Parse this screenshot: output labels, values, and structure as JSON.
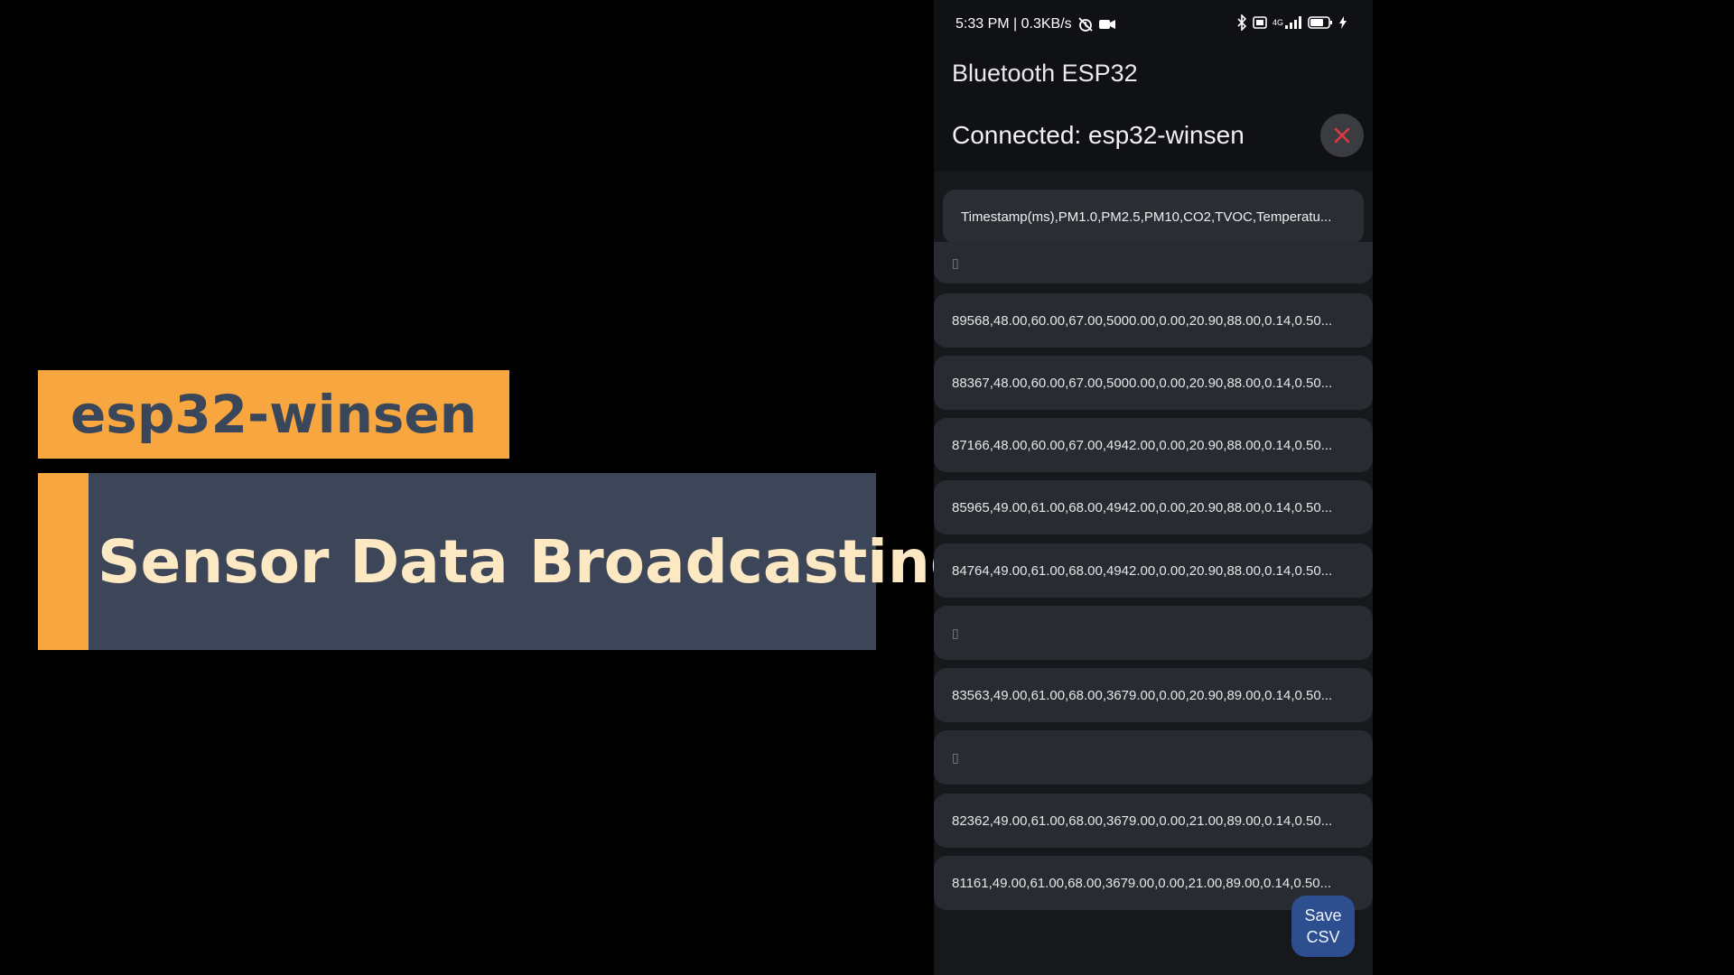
{
  "overlay": {
    "tag": "esp32-winsen",
    "banner": "Sensor Data Broadcasting",
    "colors": {
      "accent": "#f8a63f",
      "banner_bg": "#3d4658",
      "banner_text": "#fde8c4",
      "tag_text": "#3a4659"
    }
  },
  "phone": {
    "status": {
      "time_net": "5:33 PM | 0.3KB/s",
      "icons_left": [
        "alarm-off-icon",
        "video-camera-icon"
      ],
      "network_label": "4G",
      "icons_right": [
        "bluetooth-icon",
        "sim-icon",
        "signal-icon",
        "battery-icon",
        "charging-icon"
      ]
    },
    "app_title": "Bluetooth ESP32",
    "connection": "Connected: esp32-winsen",
    "disconnect_icon": "close-icon",
    "header_row": "Timestamp(ms),PM1.0,PM2.5,PM10,CO2,TVOC,Temperatu...",
    "rows": [
      {
        "text": "▯",
        "empty": true
      },
      {
        "text": "89568,48.00,60.00,67.00,5000.00,0.00,20.90,88.00,0.14,0.50...",
        "empty": false
      },
      {
        "text": "88367,48.00,60.00,67.00,5000.00,0.00,20.90,88.00,0.14,0.50...",
        "empty": false
      },
      {
        "text": "87166,48.00,60.00,67.00,4942.00,0.00,20.90,88.00,0.14,0.50...",
        "empty": false
      },
      {
        "text": "85965,49.00,61.00,68.00,4942.00,0.00,20.90,88.00,0.14,0.50...",
        "empty": false
      },
      {
        "text": "84764,49.00,61.00,68.00,4942.00,0.00,20.90,88.00,0.14,0.50...",
        "empty": false
      },
      {
        "text": "▯",
        "empty": true
      },
      {
        "text": "83563,49.00,61.00,68.00,3679.00,0.00,20.90,89.00,0.14,0.50...",
        "empty": false
      },
      {
        "text": "▯",
        "empty": true
      },
      {
        "text": "82362,49.00,61.00,68.00,3679.00,0.00,21.00,89.00,0.14,0.50...",
        "empty": false
      },
      {
        "text": "81161,49.00,61.00,68.00,3679.00,0.00,21.00,89.00,0.14,0.50...",
        "empty": false
      }
    ],
    "fab": {
      "line1": "Save",
      "line2": "CSV"
    },
    "colors": {
      "fab_bg": "#2e4f8f",
      "close_x": "#e0393e"
    }
  }
}
